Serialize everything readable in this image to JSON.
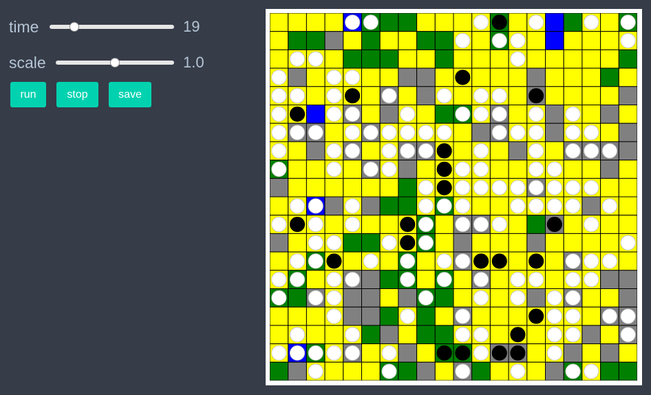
{
  "controls": {
    "time_label": "time",
    "time_value": "19",
    "time_fraction": 0.2,
    "scale_label": "scale",
    "scale_value": "1.0",
    "scale_fraction": 0.5,
    "run_label": "run",
    "stop_label": "stop",
    "save_label": "save"
  },
  "board": {
    "rows": 20,
    "cols": 20,
    "colors": {
      "Y": "#ffff00",
      "G": "#008000",
      "R": "#808080",
      "B": "#0000ff",
      "line": "#000000",
      "white_piece": "#ffffff",
      "black_piece": "#000000"
    },
    "cells": [
      "YYYYBGGGYYYYGYYBGYYG",
      "YGGRYGYYGGYYGYYBYYYY",
      "YYYYGGGYYGYYYYYYYYYG",
      "YRYYYYYRRYYYYYRYYYGY",
      "YYYYYYRYRYYYYYRYYYYR",
      "YYBYRYRYYGGYRYYRYYRY",
      "YRRYYRYYYYYRRYYRYYYR",
      "YYRYRYYRRYYYYRYYRRRR",
      "GYYYYRYRYYYYYYYYYYRY",
      "RYYYYYYGYYYYYYRYYYYY",
      "YYBRYRGGYGYYYYYYYRYY",
      "YYYYYYYYGYRRYYGRYYYY",
      "RYYYGGYYGYRYYYRYYYYY",
      "YYGYYYYGYYRYYYYYRYYY",
      "YGYYRRGGYGYRYYYYYYRR",
      "GGRYRRYRGGYYYYRYRYYR",
      "YYYYRRGYGYRYYYYYYYRR",
      "YYYYYGRYGGYYYYYYYRYR",
      "YBGYRYYRYGGYRRYYRYRY",
      "GRYYYYGGRYRGYYYRGYGG"
    ],
    "pieces": [
      "....oo.....ox.o..o.oo",
      "..........o.oo.....o.",
      ".oo..........o..........",
      "o..oo.....x..........",
      "oo.ox.o..o.oo.x.......",
      "ox.oo..o..ooo.o.o......",
      "ooo.oooooo..ooo.oo....o",
      "o..oo.ooox.o..o.ooo.....",
      "o..o.oo..xoo..oo......",
      "........oxoooooooo..o",
      ".oo.o...ooo..oooo.o",
      "oxo.o..xo.ooo..x.o..o",
      "..oo..oxo..........o",
      ".oox.o.o.ooxx.x.ooo.",
      "oo.oo..o.o.o.oo.oo",
      "o.oo....o..o.o.oo...",
      "...o...o..o...xoo.oox",
      ".o..o.....oo.x.oo..o..",
      "ooooo.o..xxoxx.o....",
      "..o...o...o..o..oo..oo"
    ]
  }
}
